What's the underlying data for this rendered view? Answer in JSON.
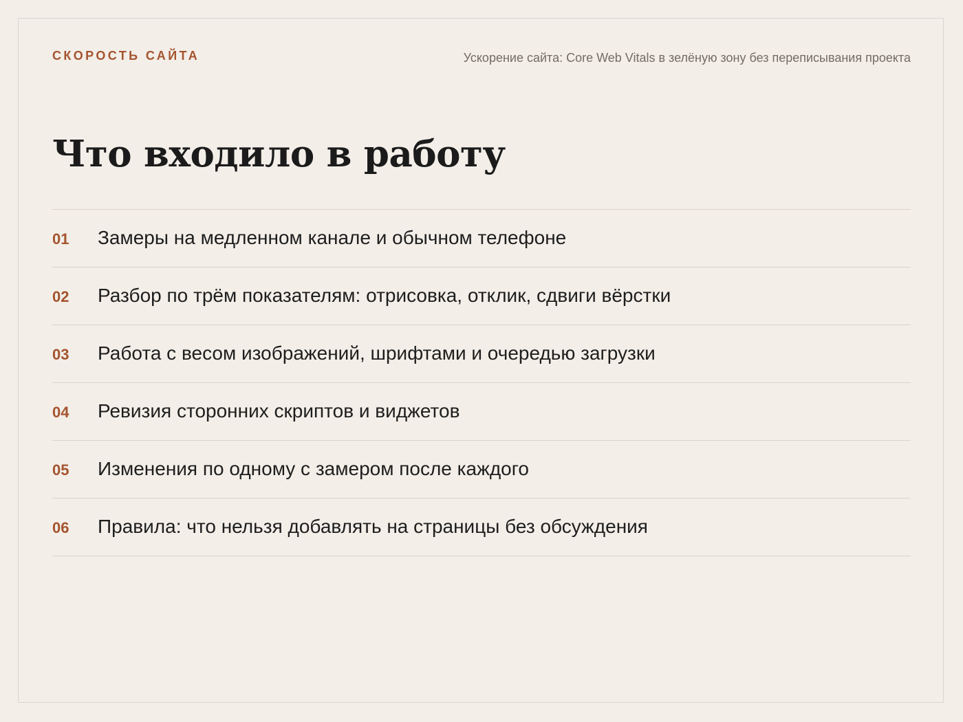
{
  "header": {
    "eyebrow": "СКОРОСТЬ САЙТА",
    "subtitle": "Ускорение сайта: Core Web Vitals в зелёную зону без переписывания проекта"
  },
  "main": {
    "title": "Что входило в работу",
    "items": [
      {
        "number": "01",
        "text": "Замеры на медленном канале и обычном телефоне"
      },
      {
        "number": "02",
        "text": "Разбор по трём показателям: отрисовка, отклик, сдвиги вёрстки"
      },
      {
        "number": "03",
        "text": "Работа с весом изображений, шрифтами и очередью загрузки"
      },
      {
        "number": "04",
        "text": "Ревизия сторонних скриптов и виджетов"
      },
      {
        "number": "05",
        "text": "Изменения по одному с замером после каждого"
      },
      {
        "number": "06",
        "text": "Правила: что нельзя добавлять на страницы без обсуждения"
      }
    ]
  },
  "colors": {
    "background": "#f3eee8",
    "accent": "#a4542e",
    "text": "#1e1e1e",
    "muted": "#746c65",
    "divider": "#d9d3cc"
  }
}
